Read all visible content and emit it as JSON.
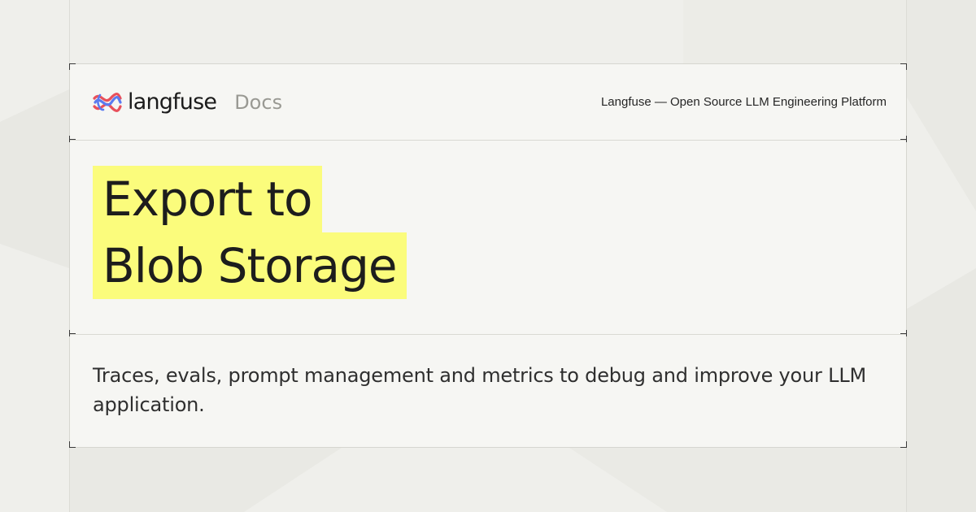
{
  "brand": {
    "name": "langfuse",
    "section": "Docs",
    "tagline": "Langfuse — Open Source LLM Engineering Platform",
    "logo_icon": "langfuse-knot-icon"
  },
  "title": {
    "lines": [
      "Export to",
      "Blob Storage"
    ],
    "highlight_color": "#fbfc7c"
  },
  "description": "Traces, evals, prompt management and metrics to debug and improve your LLM application.",
  "colors": {
    "background": "#efefeb",
    "card": "#f6f6f3",
    "logo_red": "#e8505b",
    "logo_blue": "#5b7bf0"
  }
}
